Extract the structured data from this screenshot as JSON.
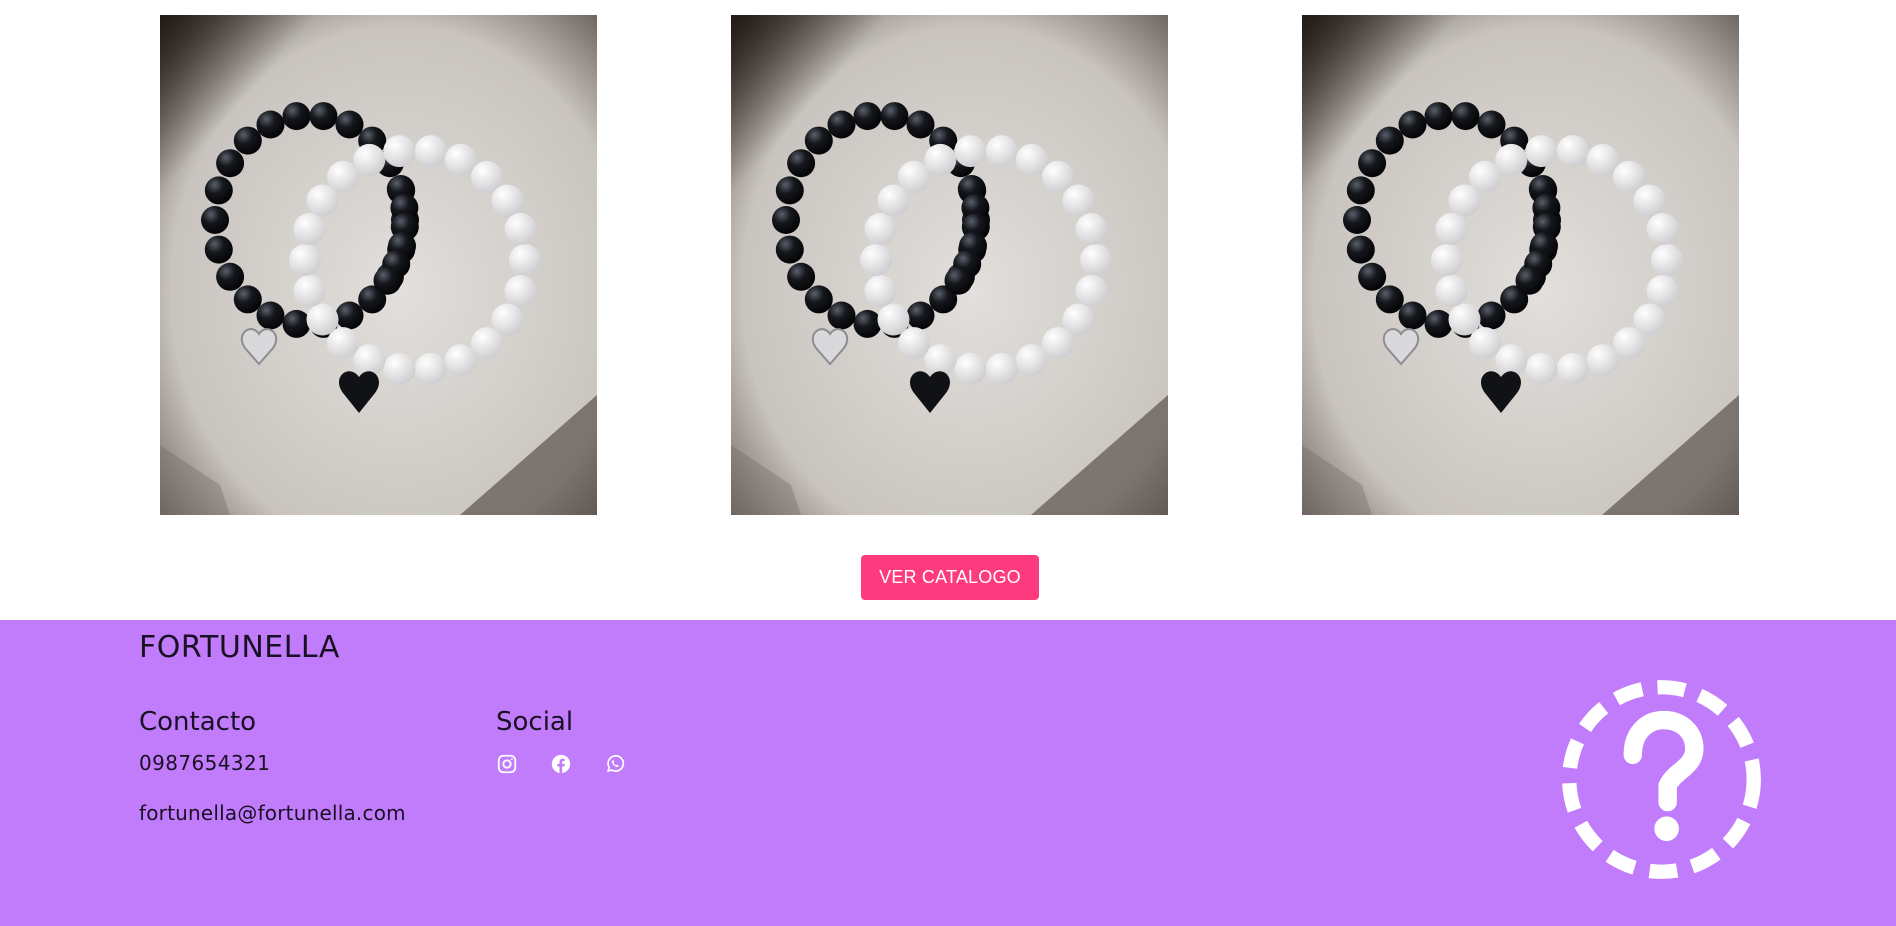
{
  "products": [
    {
      "image": "bracelet-pair-image"
    },
    {
      "image": "bracelet-pair-image"
    },
    {
      "image": "bracelet-pair-image"
    }
  ],
  "cta": {
    "label": "VER CATALOGO",
    "color": "#ff3b7f"
  },
  "footer": {
    "background": "#c17cfc",
    "brand": "FORTUNELLA",
    "contact": {
      "title": "Contacto",
      "phone": "0987654321",
      "email": "fortunella@fortunella.com"
    },
    "social": {
      "title": "Social",
      "icons": [
        "instagram-icon",
        "facebook-icon",
        "whatsapp-icon"
      ]
    },
    "help_icon": "question-mark-dashed-circle-icon"
  }
}
